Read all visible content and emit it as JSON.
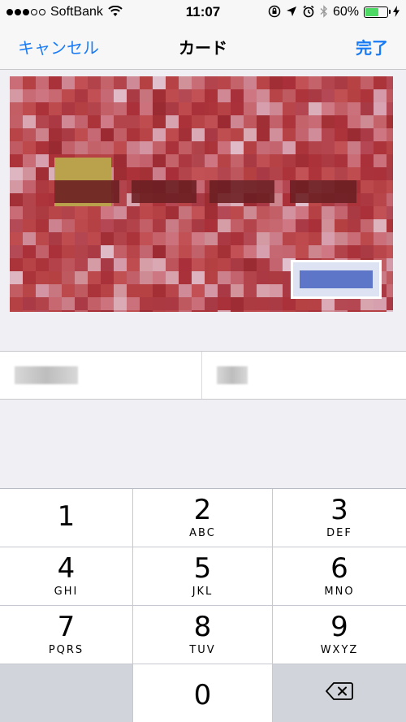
{
  "status_bar": {
    "carrier": "SoftBank",
    "time": "11:07",
    "battery_percent": "60%",
    "battery_level": 0.6,
    "battery_color": "#4cd964"
  },
  "nav": {
    "cancel_label": "キャンセル",
    "title": "カード",
    "done_label": "完了",
    "accent_color": "#1a7cf5"
  },
  "keypad": {
    "keys": [
      {
        "num": "1",
        "letters": ""
      },
      {
        "num": "2",
        "letters": "ABC"
      },
      {
        "num": "3",
        "letters": "DEF"
      },
      {
        "num": "4",
        "letters": "GHI"
      },
      {
        "num": "5",
        "letters": "JKL"
      },
      {
        "num": "6",
        "letters": "MNO"
      },
      {
        "num": "7",
        "letters": "PQRS"
      },
      {
        "num": "8",
        "letters": "TUV"
      },
      {
        "num": "9",
        "letters": "WXYZ"
      }
    ],
    "zero": "0",
    "delete_icon": "backspace-icon"
  }
}
